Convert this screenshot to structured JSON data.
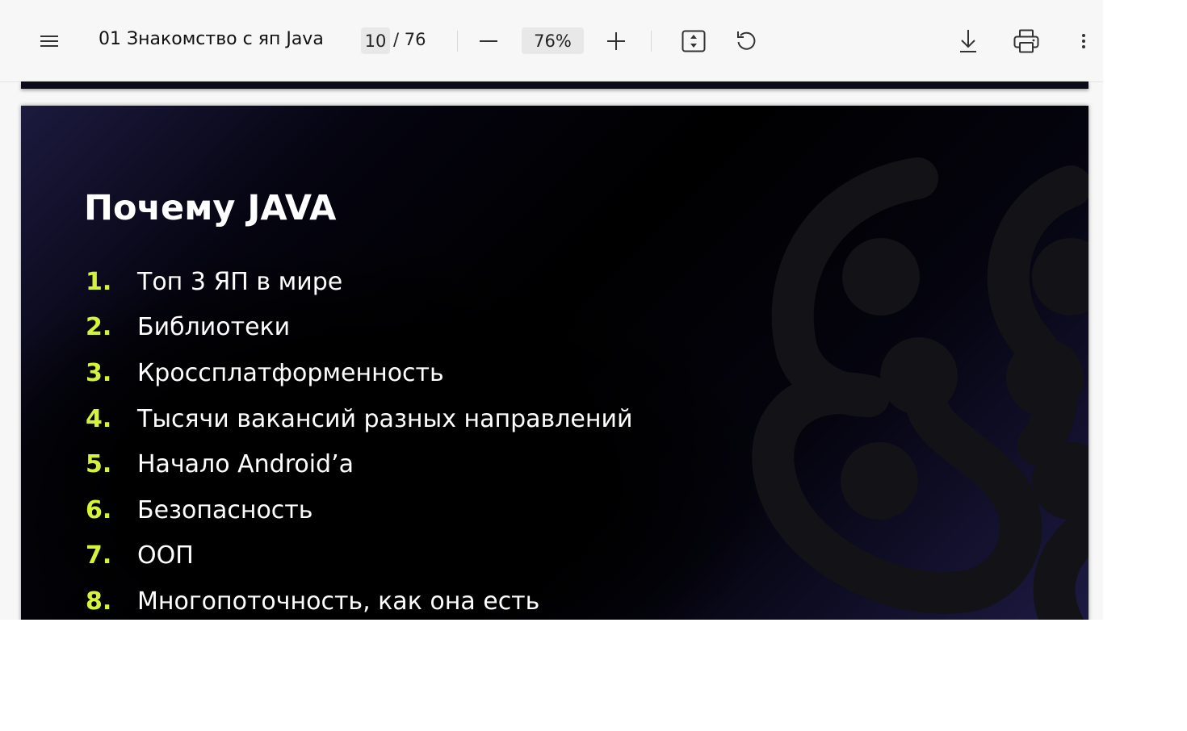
{
  "toolbar": {
    "menu_icon": "hamburger-menu-icon",
    "title": "01 Знакомство с яп Java",
    "current_page": "10",
    "total_pages": "/ 76",
    "zoom_out_icon": "minus-icon",
    "zoom_level": "76%",
    "zoom_in_icon": "plus-icon",
    "fit_icon": "fit-to-page-icon",
    "rotate_icon": "rotate-icon",
    "download_icon": "download-icon",
    "print_icon": "print-icon",
    "more_icon": "more-vertical-icon"
  },
  "slide": {
    "title": "Почему JAVA",
    "items": [
      {
        "num": "1.",
        "text": "Топ 3 ЯП в мире"
      },
      {
        "num": "2.",
        "text": "Библиотеки"
      },
      {
        "num": "3.",
        "text": "Кроссплатформенность"
      },
      {
        "num": "4.",
        "text": "Тысячи вакансий разных направлений"
      },
      {
        "num": "5.",
        "text": "Начало Android’а"
      },
      {
        "num": "6.",
        "text": "Безопасность"
      },
      {
        "num": "7.",
        "text": "ООП"
      },
      {
        "num": "8.",
        "text": "Многопоточность, как она есть"
      }
    ],
    "colors": {
      "number_accent": "#d4f43a",
      "text": "#ffffff",
      "background": "#000000"
    }
  }
}
